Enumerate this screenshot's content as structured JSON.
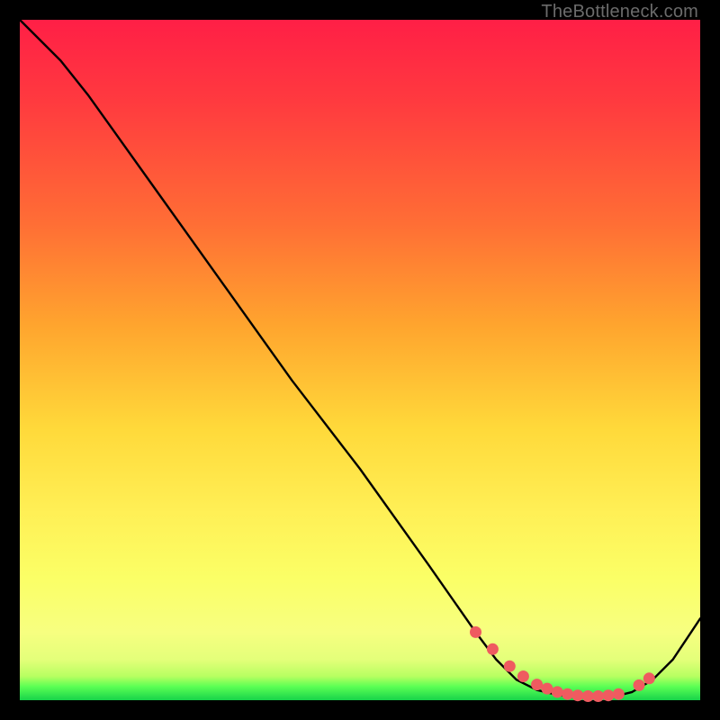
{
  "watermark": "TheBottleneck.com",
  "colors": {
    "background": "#000000",
    "line": "#000000",
    "dot": "#ef5b60",
    "dot_stroke": "#ef5b60"
  },
  "chart_data": {
    "type": "line",
    "title": "",
    "xlabel": "",
    "ylabel": "",
    "xlim": [
      0,
      100
    ],
    "ylim": [
      0,
      100
    ],
    "grid": false,
    "legend": false,
    "series": [
      {
        "name": "curve",
        "x": [
          0,
          6,
          10,
          20,
          30,
          40,
          50,
          60,
          67,
          70,
          73,
          76,
          79,
          82,
          85,
          88,
          90,
          93,
          96,
          100
        ],
        "y": [
          100,
          94,
          89,
          75,
          61,
          47,
          34,
          20,
          10,
          6,
          3,
          1.5,
          0.8,
          0.5,
          0.5,
          0.7,
          1.2,
          3,
          6,
          12
        ]
      }
    ],
    "annotations": {
      "dots_x": [
        67,
        69.5,
        72,
        74,
        76,
        77.5,
        79,
        80.5,
        82,
        83.5,
        85,
        86.5,
        88,
        91,
        92.5
      ],
      "dots_y": [
        10,
        7.5,
        5,
        3.5,
        2.3,
        1.7,
        1.2,
        0.9,
        0.7,
        0.6,
        0.6,
        0.7,
        0.9,
        2.2,
        3.2
      ]
    }
  }
}
